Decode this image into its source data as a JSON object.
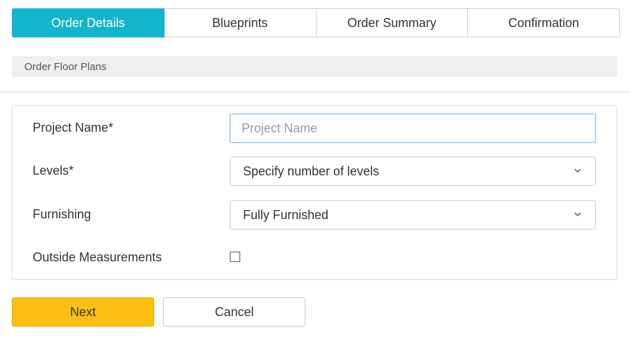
{
  "tabs": [
    {
      "label": "Order Details",
      "active": true
    },
    {
      "label": "Blueprints",
      "active": false
    },
    {
      "label": "Order Summary",
      "active": false
    },
    {
      "label": "Confirmation",
      "active": false
    }
  ],
  "breadcrumb": "Order Floor Plans",
  "form": {
    "project_name": {
      "label": "Project Name*",
      "placeholder": "Project Name",
      "value": ""
    },
    "levels": {
      "label": "Levels*",
      "selected": "Specify number of levels"
    },
    "furnishing": {
      "label": "Furnishing",
      "selected": "Fully Furnished"
    },
    "outside_measurements": {
      "label": "Outside Measurements",
      "checked": false
    }
  },
  "buttons": {
    "next": "Next",
    "cancel": "Cancel"
  },
  "colors": {
    "active_tab": "#12b5cb",
    "primary_button": "#fdc010"
  },
  "icons": {
    "select_arrow": "chevron-down-icon"
  }
}
